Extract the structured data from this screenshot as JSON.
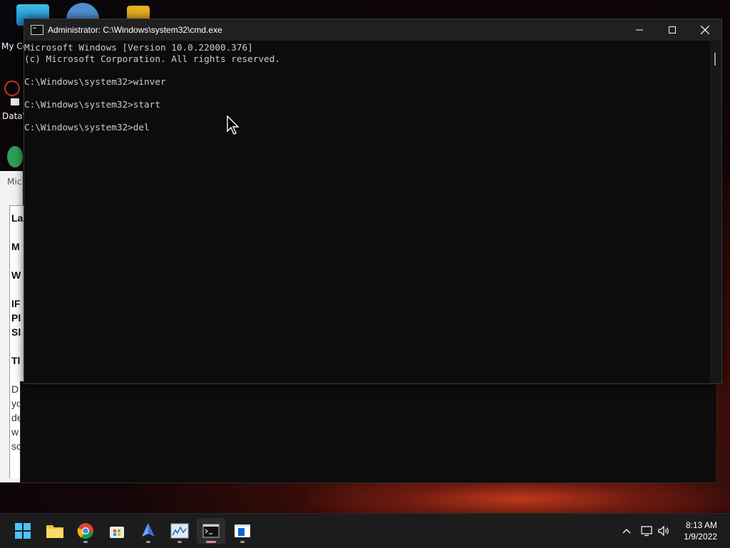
{
  "desktop": {
    "labels": {
      "my_computer": "My Co",
      "datawrapper": "DataW"
    },
    "background_window": {
      "title": "Mic",
      "fragments": [
        "La",
        "M",
        "W",
        "IF",
        "Pl",
        "Sl",
        "Tl",
        "D",
        "yo",
        "de",
        "w",
        "sc"
      ]
    }
  },
  "cmd_window": {
    "title": "Administrator: C:\\Windows\\system32\\cmd.exe",
    "lines": [
      "Microsoft Windows [Version 10.0.22000.376]",
      "(c) Microsoft Corporation. All rights reserved.",
      "",
      "C:\\Windows\\system32>winver",
      "",
      "C:\\Windows\\system32>start",
      "",
      "C:\\Windows\\system32>del"
    ]
  },
  "taskbar": {
    "apps": [
      "start-icon",
      "file-explorer-icon",
      "chrome-icon",
      "store-icon",
      "app-icon",
      "resource-monitor-icon",
      "terminal-icon",
      "notepad-icon"
    ],
    "time": "8:13 AM",
    "date": "1/9/2022"
  },
  "colors": {
    "console_bg": "#0c0c0c",
    "console_text": "#cccccc",
    "titlebar_bg": "#202020",
    "taskbar_bg": "#1c1c1c"
  }
}
